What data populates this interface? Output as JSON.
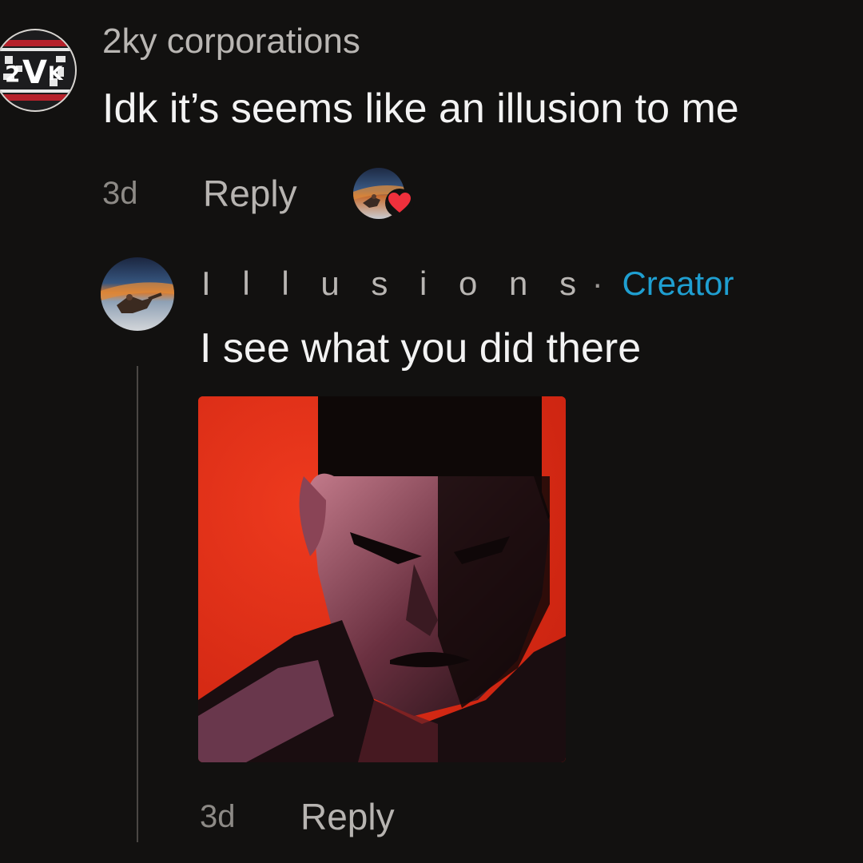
{
  "comments": [
    {
      "username": "2ky corporations",
      "avatar_icon": "2ky-logo-avatar",
      "text": "Idk it’s seems like an illusion to me",
      "timestamp": "3d",
      "reply_label": "Reply",
      "creator_liked": true,
      "like_badge_icon": "heart-icon",
      "like_badge_color": "#f0303c"
    },
    {
      "username": "I l l u s i o n s",
      "separator": "·",
      "badge": "Creator",
      "badge_color": "#1f9fd1",
      "avatar_icon": "space-figure-avatar",
      "text": "I see what you did there",
      "attachment": "red-portrait-image",
      "timestamp": "3d",
      "reply_label": "Reply"
    }
  ],
  "colors": {
    "background": "#121110",
    "primary_text": "#f3f3f3",
    "secondary_text": "#b9b6b3",
    "image_background": "#df2a18"
  }
}
